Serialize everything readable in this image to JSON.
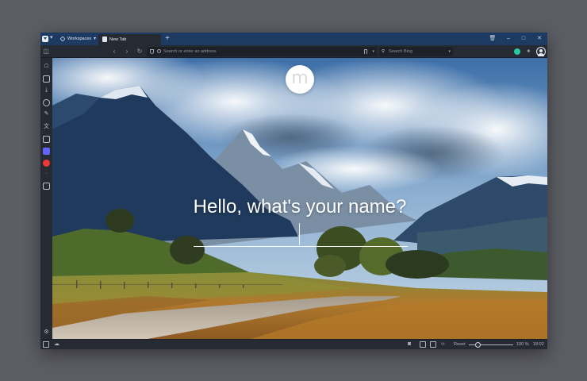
{
  "tabbar": {
    "workspaces_label": "Workspaces",
    "tab_title": "New Tab",
    "new_tab_symbol": "+",
    "window_controls": [
      "trash-icon",
      "minimize-icon",
      "maximize-icon",
      "close-icon"
    ]
  },
  "addressbar": {
    "url_placeholder": "Search or enter an address",
    "search_placeholder": "Search Bing"
  },
  "sidepanel": {
    "icons": [
      "bookmarks-icon",
      "reading-list-icon",
      "downloads-icon",
      "history-icon",
      "notes-icon",
      "translate-icon",
      "window-icon",
      "mastodon-icon",
      "vivaldi-icon",
      "add-panel-icon",
      "settings-icon"
    ]
  },
  "startpage": {
    "greeting": "Hello, what's your name?",
    "logo_letter": "m"
  },
  "statusbar": {
    "reset_label": "Reset",
    "zoom_percent": "100 %",
    "clock": "18:02",
    "zoom_level": 0.15
  },
  "colors": {
    "tabbar_bg": "#1d3a63",
    "chrome_bg": "#262a33",
    "accent": "#2bc6a3"
  }
}
